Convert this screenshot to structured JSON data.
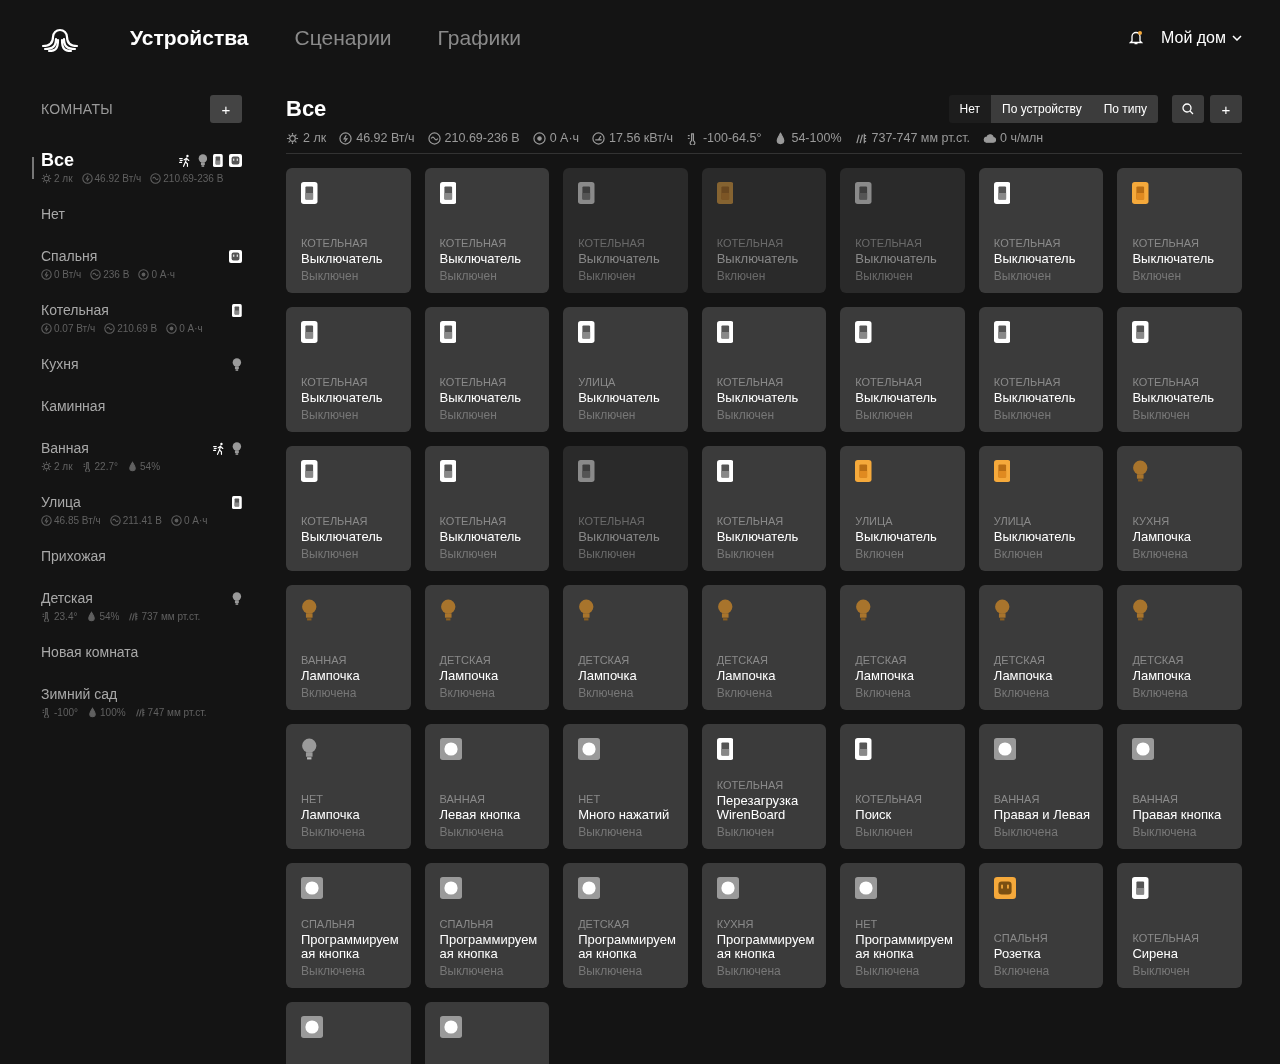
{
  "header": {
    "tabs": [
      {
        "label": "Устройства",
        "selected": true
      },
      {
        "label": "Сценарии",
        "selected": false
      },
      {
        "label": "Графики",
        "selected": false
      }
    ],
    "home": "Мой дом"
  },
  "sidebar": {
    "title": "КОМНАТЫ",
    "add_label": "+",
    "rooms": [
      {
        "name": "Все",
        "selected": true,
        "stats": [
          {
            "kind": "lux",
            "text": "2 лк"
          },
          {
            "kind": "power",
            "text": "46.92 Вт/ч"
          },
          {
            "kind": "voltage",
            "text": "210.69-236 В"
          }
        ],
        "devices": [
          {
            "kind": "motion"
          },
          {
            "kind": "bulb"
          },
          {
            "kind": "switch"
          },
          {
            "kind": "socket"
          }
        ]
      },
      {
        "name": "Нет",
        "selected": false
      },
      {
        "name": "Спальня",
        "selected": false,
        "stats": [
          {
            "kind": "power",
            "text": "0 Вт/ч"
          },
          {
            "kind": "voltage",
            "text": "236 В"
          },
          {
            "kind": "current",
            "text": "0 А·ч"
          }
        ],
        "devices": [
          {
            "kind": "socket"
          }
        ]
      },
      {
        "name": "Котельная",
        "selected": false,
        "stats": [
          {
            "kind": "power",
            "text": "0.07 Вт/ч"
          },
          {
            "kind": "voltage",
            "text": "210.69 В"
          },
          {
            "kind": "current",
            "text": "0 А·ч"
          }
        ],
        "devices": [
          {
            "kind": "switch"
          }
        ]
      },
      {
        "name": "Кухня",
        "selected": false,
        "devices": [
          {
            "kind": "bulb"
          }
        ]
      },
      {
        "name": "Каминная",
        "selected": false
      },
      {
        "name": "Ванная",
        "selected": false,
        "stats": [
          {
            "kind": "lux",
            "text": "2 лк"
          },
          {
            "kind": "temp",
            "text": "22.7°"
          },
          {
            "kind": "humidity",
            "text": "54%"
          }
        ],
        "devices": [
          {
            "kind": "motion"
          },
          {
            "kind": "bulb"
          }
        ]
      },
      {
        "name": "Улица",
        "selected": false,
        "stats": [
          {
            "kind": "power",
            "text": "46.85 Вт/ч"
          },
          {
            "kind": "voltage",
            "text": "211.41 В"
          },
          {
            "kind": "current",
            "text": "0 А·ч"
          }
        ],
        "devices": [
          {
            "kind": "switch"
          }
        ]
      },
      {
        "name": "Прихожая",
        "selected": false
      },
      {
        "name": "Детская",
        "selected": false,
        "stats": [
          {
            "kind": "temp",
            "text": "23.4°"
          },
          {
            "kind": "humidity",
            "text": "54%"
          },
          {
            "kind": "pressure",
            "text": "737 мм рт.ст."
          }
        ],
        "devices": [
          {
            "kind": "bulb"
          }
        ]
      },
      {
        "name": "Новая комната",
        "selected": false
      },
      {
        "name": "Зимний сад",
        "selected": false,
        "stats": [
          {
            "kind": "temp",
            "text": "-100°"
          },
          {
            "kind": "humidity",
            "text": "100%"
          },
          {
            "kind": "pressure",
            "text": "747 мм рт.ст."
          }
        ]
      }
    ]
  },
  "main": {
    "title": "Все",
    "grouping": [
      {
        "label": "Нет",
        "selected": true
      },
      {
        "label": "По устройству",
        "selected": false
      },
      {
        "label": "По типу",
        "selected": false
      }
    ],
    "add_label": "+",
    "stats": [
      {
        "kind": "lux",
        "text": "2 лк"
      },
      {
        "kind": "power",
        "text": "46.92 Вт/ч"
      },
      {
        "kind": "voltage",
        "text": "210.69-236 В"
      },
      {
        "kind": "current",
        "text": "0 А·ч"
      },
      {
        "kind": "energy",
        "text": "17.56 кВт/ч"
      },
      {
        "kind": "temp",
        "text": "-100-64.5°"
      },
      {
        "kind": "humidity",
        "text": "54-100%"
      },
      {
        "kind": "pressure",
        "text": "737-747 мм рт.ст."
      },
      {
        "kind": "co2",
        "text": "0 ч/млн"
      }
    ],
    "tiles": [
      {
        "kind": "switch",
        "room": "КОТЕЛЬНАЯ",
        "name": "Выключатель",
        "status": "Выключен",
        "on": false,
        "unavailable": false
      },
      {
        "kind": "switch",
        "room": "КОТЕЛЬНАЯ",
        "name": "Выключатель",
        "status": "Выключен",
        "on": false,
        "unavailable": false
      },
      {
        "kind": "switch",
        "room": "КОТЕЛЬНАЯ",
        "name": "Выключатель",
        "status": "Выключен",
        "on": false,
        "unavailable": true
      },
      {
        "kind": "switch",
        "room": "КОТЕЛЬНАЯ",
        "name": "Выключатель",
        "status": "Включен",
        "on": true,
        "unavailable": true
      },
      {
        "kind": "switch",
        "room": "КОТЕЛЬНАЯ",
        "name": "Выключатель",
        "status": "Выключен",
        "on": false,
        "unavailable": true
      },
      {
        "kind": "switch",
        "room": "КОТЕЛЬНАЯ",
        "name": "Выключатель",
        "status": "Выключен",
        "on": false,
        "unavailable": false
      },
      {
        "kind": "switch",
        "room": "КОТЕЛЬНАЯ",
        "name": "Выключатель",
        "status": "Включен",
        "on": true,
        "unavailable": false
      },
      {
        "kind": "switch",
        "room": "КОТЕЛЬНАЯ",
        "name": "Выключатель",
        "status": "Выключен",
        "on": false,
        "unavailable": false
      },
      {
        "kind": "switch",
        "room": "КОТЕЛЬНАЯ",
        "name": "Выключатель",
        "status": "Выключен",
        "on": false,
        "unavailable": false
      },
      {
        "kind": "switch",
        "room": "УЛИЦА",
        "name": "Выключатель",
        "status": "Выключен",
        "on": false,
        "unavailable": false
      },
      {
        "kind": "switch",
        "room": "КОТЕЛЬНАЯ",
        "name": "Выключатель",
        "status": "Выключен",
        "on": false,
        "unavailable": false
      },
      {
        "kind": "switch",
        "room": "КОТЕЛЬНАЯ",
        "name": "Выключатель",
        "status": "Выключен",
        "on": false,
        "unavailable": false
      },
      {
        "kind": "switch",
        "room": "КОТЕЛЬНАЯ",
        "name": "Выключатель",
        "status": "Выключен",
        "on": false,
        "unavailable": false
      },
      {
        "kind": "switch",
        "room": "КОТЕЛЬНАЯ",
        "name": "Выключатель",
        "status": "Выключен",
        "on": false,
        "unavailable": false
      },
      {
        "kind": "switch",
        "room": "КОТЕЛЬНАЯ",
        "name": "Выключатель",
        "status": "Выключен",
        "on": false,
        "unavailable": false
      },
      {
        "kind": "switch",
        "room": "КОТЕЛЬНАЯ",
        "name": "Выключатель",
        "status": "Выключен",
        "on": false,
        "unavailable": false
      },
      {
        "kind": "switch",
        "room": "КОТЕЛЬНАЯ",
        "name": "Выключатель",
        "status": "Выключен",
        "on": false,
        "unavailable": true
      },
      {
        "kind": "switch",
        "room": "КОТЕЛЬНАЯ",
        "name": "Выключатель",
        "status": "Выключен",
        "on": false,
        "unavailable": false
      },
      {
        "kind": "switch",
        "room": "УЛИЦА",
        "name": "Выключатель",
        "status": "Включен",
        "on": true,
        "unavailable": false
      },
      {
        "kind": "switch",
        "room": "УЛИЦА",
        "name": "Выключатель",
        "status": "Включен",
        "on": true,
        "unavailable": false
      },
      {
        "kind": "bulb",
        "room": "КУХНЯ",
        "name": "Лампочка",
        "status": "Включена",
        "on": true,
        "unavailable": false
      },
      {
        "kind": "bulb",
        "room": "ВАННАЯ",
        "name": "Лампочка",
        "status": "Включена",
        "on": true,
        "unavailable": false
      },
      {
        "kind": "bulb",
        "room": "ДЕТСКАЯ",
        "name": "Лампочка",
        "status": "Включена",
        "on": true,
        "unavailable": false
      },
      {
        "kind": "bulb",
        "room": "ДЕТСКАЯ",
        "name": "Лампочка",
        "status": "Включена",
        "on": true,
        "unavailable": false
      },
      {
        "kind": "bulb",
        "room": "ДЕТСКАЯ",
        "name": "Лампочка",
        "status": "Включена",
        "on": true,
        "unavailable": false
      },
      {
        "kind": "bulb",
        "room": "ДЕТСКАЯ",
        "name": "Лампочка",
        "status": "Включена",
        "on": true,
        "unavailable": false
      },
      {
        "kind": "bulb",
        "room": "ДЕТСКАЯ",
        "name": "Лампочка",
        "status": "Включена",
        "on": true,
        "unavailable": false
      },
      {
        "kind": "bulb",
        "room": "ДЕТСКАЯ",
        "name": "Лампочка",
        "status": "Включена",
        "on": true,
        "unavailable": false
      },
      {
        "kind": "bulb",
        "room": "НЕТ",
        "name": "Лампочка",
        "status": "Выключена",
        "on": false,
        "unavailable": false
      },
      {
        "kind": "button",
        "room": "ВАННАЯ",
        "name": "Левая кнопка",
        "status": "Выключена",
        "on": false,
        "unavailable": false
      },
      {
        "kind": "button",
        "room": "НЕТ",
        "name": "Много нажатий",
        "status": "Выключена",
        "on": false,
        "unavailable": false
      },
      {
        "kind": "switch",
        "room": "КОТЕЛЬНАЯ",
        "name": "Перезагрузка WirenBoard",
        "status": "Выключен",
        "on": false,
        "unavailable": false
      },
      {
        "kind": "switch",
        "room": "КОТЕЛЬНАЯ",
        "name": "Поиск",
        "status": "Выключен",
        "on": false,
        "unavailable": false
      },
      {
        "kind": "button",
        "room": "ВАННАЯ",
        "name": "Правая и Левая",
        "status": "Выключена",
        "on": false,
        "unavailable": false
      },
      {
        "kind": "button",
        "room": "ВАННАЯ",
        "name": "Правая кнопка",
        "status": "Выключена",
        "on": false,
        "unavailable": false
      },
      {
        "kind": "button",
        "room": "СПАЛЬНЯ",
        "name": "Программируемая кнопка",
        "status": "Выключена",
        "on": false,
        "unavailable": false
      },
      {
        "kind": "button",
        "room": "СПАЛЬНЯ",
        "name": "Программируемая кнопка",
        "status": "Выключена",
        "on": false,
        "unavailable": false
      },
      {
        "kind": "button",
        "room": "ДЕТСКАЯ",
        "name": "Программируемая кнопка",
        "status": "Выключена",
        "on": false,
        "unavailable": false
      },
      {
        "kind": "button",
        "room": "КУХНЯ",
        "name": "Программируемая кнопка",
        "status": "Выключена",
        "on": false,
        "unavailable": false
      },
      {
        "kind": "button",
        "room": "НЕТ",
        "name": "Программируемая кнопка",
        "status": "Выключена",
        "on": false,
        "unavailable": false
      },
      {
        "kind": "socket",
        "room": "СПАЛЬНЯ",
        "name": "Розетка",
        "status": "Включена",
        "on": true,
        "unavailable": false
      },
      {
        "kind": "switch",
        "room": "КОТЕЛЬНАЯ",
        "name": "Сирена",
        "status": "Выключен",
        "on": false,
        "unavailable": false
      },
      {
        "kind": "button",
        "on": false,
        "unavailable": false
      },
      {
        "kind": "button",
        "on": false,
        "unavailable": false
      }
    ]
  }
}
